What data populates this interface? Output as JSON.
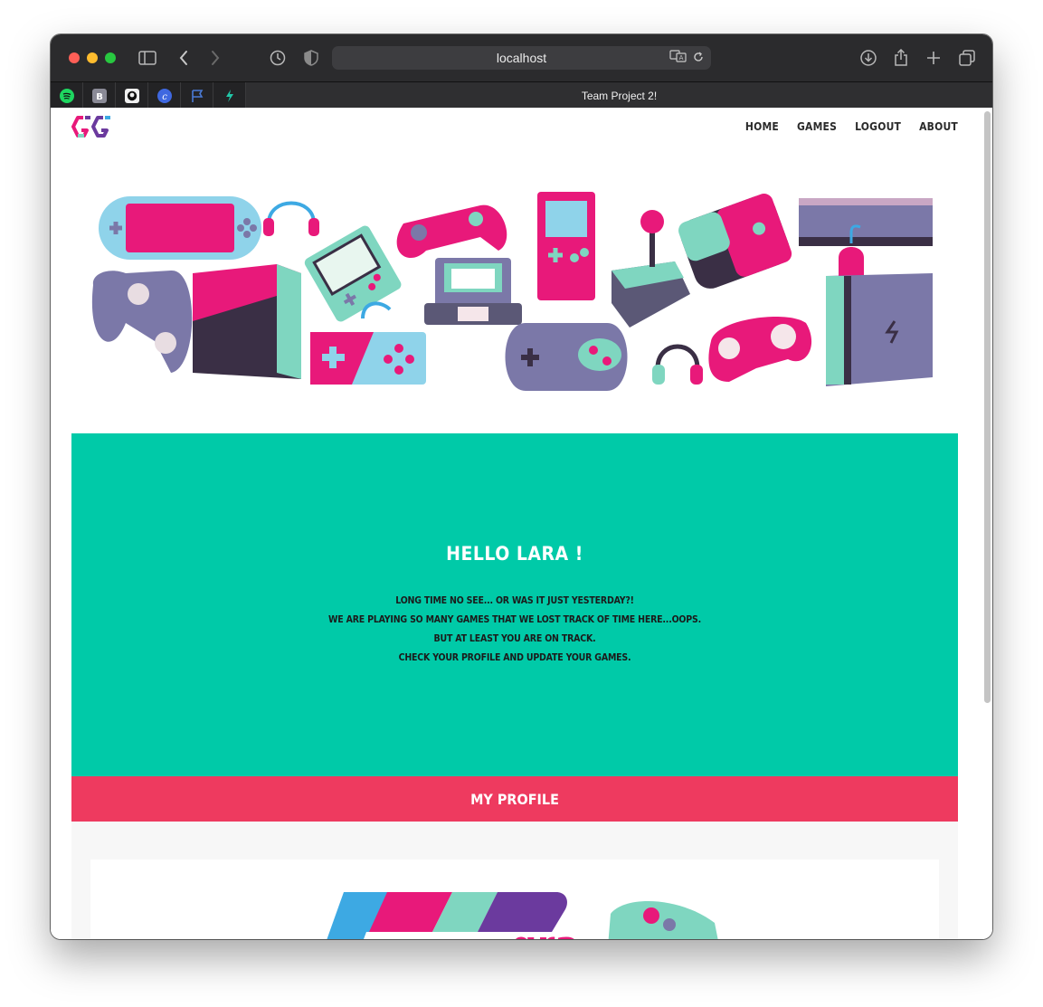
{
  "browser": {
    "address": "localhost",
    "active_tab_title": "Team Project 2!",
    "pinned_tabs": [
      "spotify-icon",
      "bootstrap-icon",
      "github-icon",
      "canva-icon",
      "flag-icon",
      "bolt-icon"
    ]
  },
  "nav": {
    "items": [
      "HOME",
      "GAMES",
      "LOGOUT",
      "ABOUT"
    ]
  },
  "hero": {
    "title": "HELLO LARA !",
    "lines": [
      "LONG TIME NO SEE... OR WAS IT JUST YESTERDAY?!",
      "WE ARE PLAYING SO MANY GAMES THAT WE LOST TRACK OF TIME HERE...OOPS.",
      "BUT AT LEAST YOU ARE ON TRACK.",
      "CHECK YOUR PROFILE AND UPDATE YOUR GAMES."
    ]
  },
  "profile": {
    "heading": "MY PROFILE"
  },
  "colors": {
    "teal": "#00caa8",
    "pink": "#ee3a5f",
    "magenta": "#e8197a",
    "purple": "#7b78a8",
    "mint": "#7fd6c0"
  }
}
